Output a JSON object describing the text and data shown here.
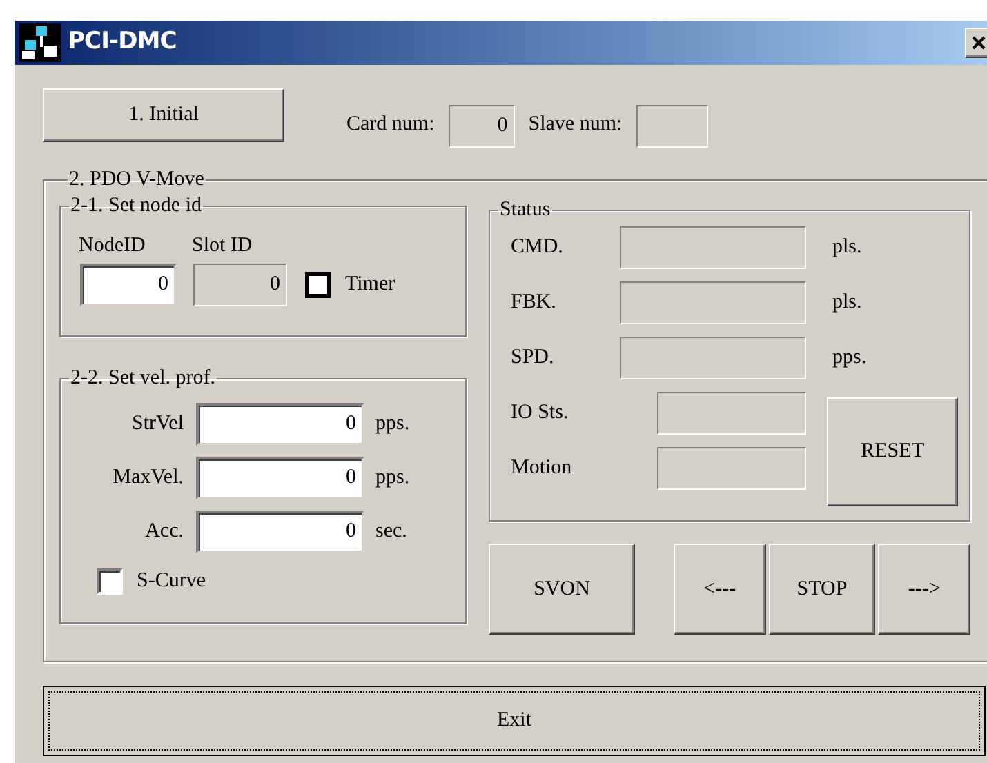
{
  "window": {
    "title": "PCI-DMC"
  },
  "initial_button": "1. Initial",
  "card_num": {
    "label": "Card num:",
    "value": "0"
  },
  "slave_num": {
    "label": "Slave num:"
  },
  "pdo_group": {
    "title": "2. PDO V-Move",
    "node_group": {
      "title": "2-1. Set node id",
      "node_id": {
        "label": "NodeID",
        "value": "0"
      },
      "slot_id": {
        "label": "Slot ID",
        "value": "0"
      },
      "timer": {
        "label": "Timer",
        "checked": false
      }
    },
    "vel_group": {
      "title": "2-2. Set vel. prof.",
      "rows": [
        {
          "label": "StrVel",
          "value": "0",
          "unit": "pps."
        },
        {
          "label": "MaxVel.",
          "value": "0",
          "unit": "pps."
        },
        {
          "label": "Acc.",
          "value": "0",
          "unit": "sec."
        }
      ],
      "s_curve": {
        "label": "S-Curve",
        "checked": false
      }
    },
    "status_group": {
      "title": "Status",
      "rows": [
        {
          "label": "CMD.",
          "unit": "pls."
        },
        {
          "label": "FBK.",
          "unit": "pls."
        },
        {
          "label": "SPD.",
          "unit": "pps."
        },
        {
          "label": "IO Sts."
        },
        {
          "label": "Motion"
        }
      ],
      "reset_button": "RESET"
    },
    "buttons": [
      "SVON",
      "<---",
      "STOP",
      "--->"
    ]
  },
  "exit_button": {
    "label": "Exit",
    "focused": true
  }
}
